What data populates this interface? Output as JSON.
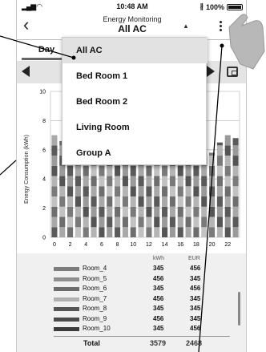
{
  "status": {
    "time": "10:48 AM",
    "battery": "100%"
  },
  "header": {
    "subtitle": "Energy Monitoring",
    "title": "All AC"
  },
  "tabs": {
    "day": "Day"
  },
  "menu": {
    "selected": "All AC",
    "items": [
      "All AC",
      "Bed Room 1",
      "Bed Room 2",
      "Living Room",
      "Group A"
    ]
  },
  "chart_data": {
    "type": "bar",
    "stacked": true,
    "ylabel": "Energy Consumption (kWh)",
    "ylim": [
      0,
      10
    ],
    "yticks": [
      0,
      2,
      4,
      6,
      8,
      10
    ],
    "x": [
      0,
      1,
      2,
      3,
      4,
      5,
      6,
      7,
      8,
      9,
      10,
      11,
      12,
      13,
      14,
      15,
      16,
      17,
      18,
      19,
      20,
      21,
      22,
      23
    ],
    "xticks": [
      "0",
      "2",
      "4",
      "6",
      "8",
      "10",
      "12",
      "14",
      "16",
      "18",
      "20",
      "22"
    ],
    "totals": [
      7.0,
      6.6,
      6.8,
      6.4,
      6.0,
      5.7,
      5.7,
      5.7,
      5.7,
      5.7,
      5.7,
      5.7,
      5.7,
      5.7,
      5.7,
      5.7,
      5.7,
      5.7,
      5.7,
      5.7,
      5.8,
      6.5,
      7.0,
      6.8
    ],
    "segment_colors": [
      "#5a5a5a",
      "#a8a8a8",
      "#6e6e6e",
      "#c2c2c2",
      "#7a7a7a",
      "#b4b4b4",
      "#555555",
      "#9a9a9a"
    ],
    "grid": true
  },
  "legend": {
    "col_kwh": "kWh",
    "col_eur": "EUR",
    "rows": [
      {
        "name": "Room_4",
        "kwh": "345",
        "eur": "456",
        "color": "#7c7c7c"
      },
      {
        "name": "Room_5",
        "kwh": "456",
        "eur": "345",
        "color": "#8e8e8e"
      },
      {
        "name": "Room_6",
        "kwh": "345",
        "eur": "456",
        "color": "#6c6c6c"
      },
      {
        "name": "Room_7",
        "kwh": "456",
        "eur": "345",
        "color": "#b0b0b0"
      },
      {
        "name": "Room_8",
        "kwh": "345",
        "eur": "345",
        "color": "#555555"
      },
      {
        "name": "Room_9",
        "kwh": "456",
        "eur": "345",
        "color": "#4a4a4a"
      },
      {
        "name": "Room_10",
        "kwh": "345",
        "eur": "456",
        "color": "#3c3c3c"
      }
    ],
    "total_label": "Total",
    "total_kwh": "3579",
    "total_eur": "2468"
  }
}
